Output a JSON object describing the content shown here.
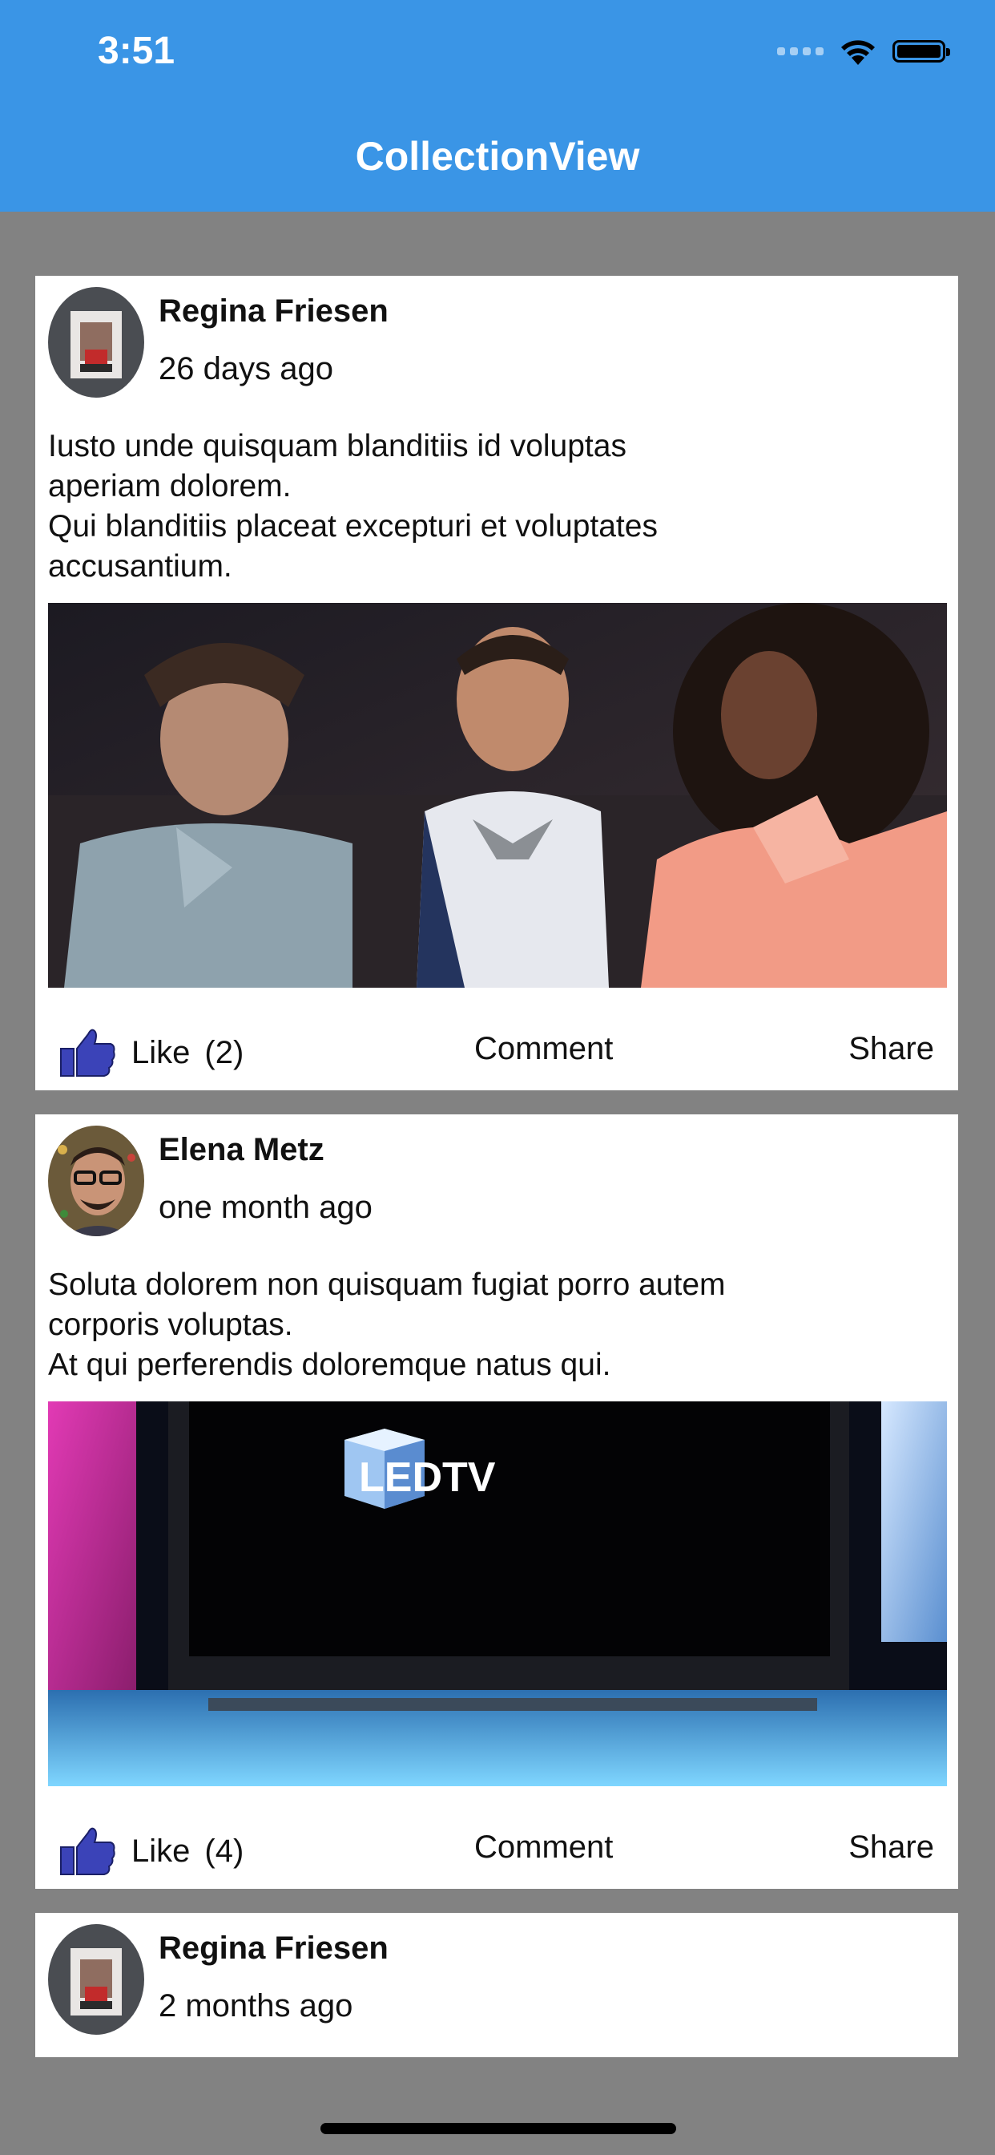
{
  "status_bar": {
    "time": "3:51"
  },
  "nav": {
    "title": "CollectionView"
  },
  "posts": [
    {
      "author": "Regina Friesen",
      "time": "26 days ago",
      "text_lines": [
        "Iusto unde quisquam blanditiis id voluptas",
        "aperiam dolorem.",
        "Qui blanditiis placeat excepturi et voluptates",
        "accusantium."
      ],
      "like_label": "Like",
      "like_count": "(2)",
      "comment_label": "Comment",
      "share_label": "Share"
    },
    {
      "author": "Elena Metz",
      "time": "one month ago",
      "text_lines": [
        "Soluta dolorem non quisquam fugiat porro autem",
        "corporis voluptas.",
        "At qui perferendis doloremque natus qui."
      ],
      "photo_text": "LEDTV",
      "like_label": "Like",
      "like_count": "(4)",
      "comment_label": "Comment",
      "share_label": "Share"
    },
    {
      "author": "Regina Friesen",
      "time": "2 months ago"
    }
  ],
  "colors": {
    "nav_bg": "#3a95e6",
    "page_bg": "#828282",
    "like_icon": "#3b43b8"
  }
}
